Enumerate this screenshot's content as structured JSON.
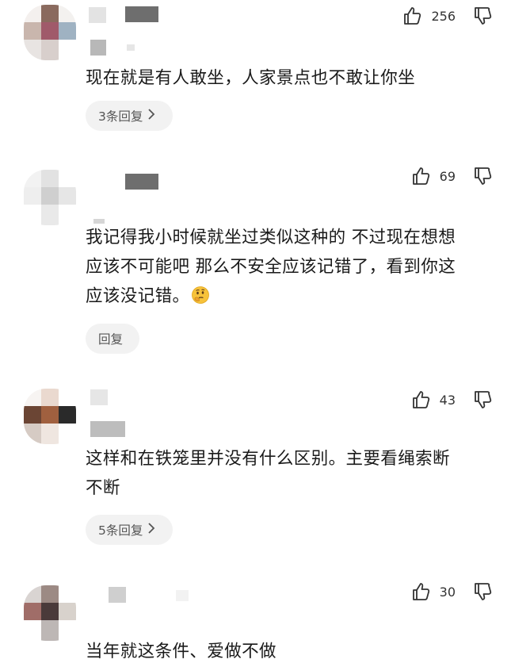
{
  "comments": [
    {
      "likes": "256",
      "text": "现在就是有人敢坐，人家景点也不敢让你坐",
      "reply_label": "3条回复",
      "has_chevron": true
    },
    {
      "likes": "69",
      "text_line1": "我记得我小时候就坐过类似这种的  不过现在想想",
      "text_line2": "应该不可能吧  那么不安全应该记错了，看到你这",
      "text_line3": "应该没记错。",
      "emoji": "thinking-face",
      "reply_label": "回复",
      "has_chevron": false
    },
    {
      "likes": "43",
      "text_line1": "这样和在铁笼里并没有什么区别。主要看绳索断",
      "text_line2": "不断",
      "reply_label": "5条回复",
      "has_chevron": true
    },
    {
      "likes": "30",
      "text": "当年就这条件、爱做不做"
    }
  ],
  "icons": {
    "like": "thumbs-up-icon",
    "dislike": "thumbs-down-icon",
    "chevron": "chevron-right-icon"
  },
  "colors": {
    "text": "#1a1a1a",
    "pill_bg": "#f2f2f2",
    "icon": "#333333"
  }
}
